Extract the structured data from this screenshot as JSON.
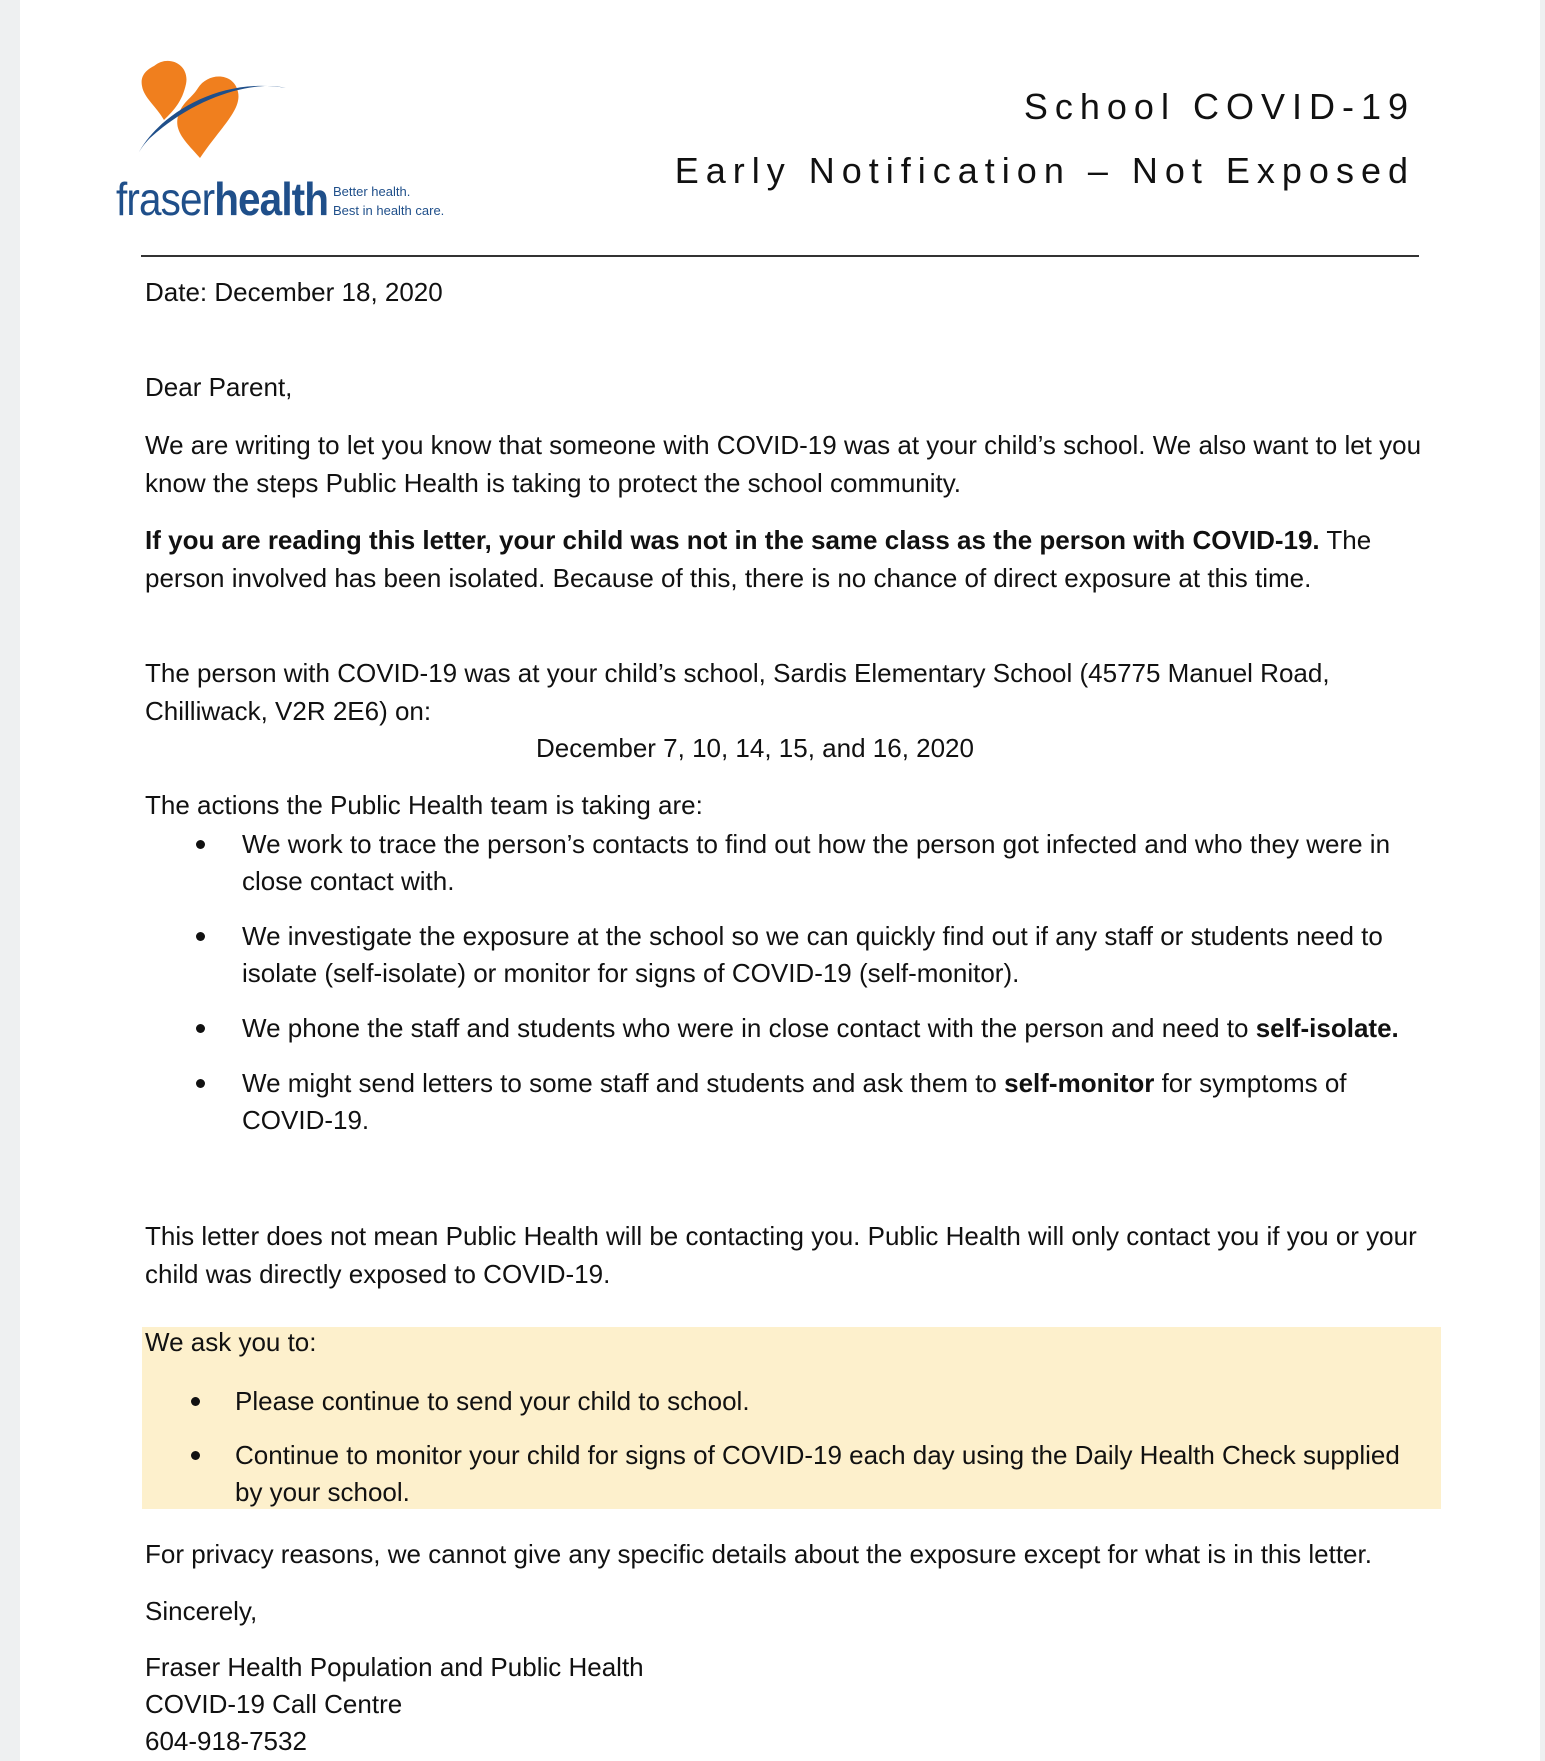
{
  "header": {
    "logo": {
      "word_light": "fraser",
      "word_bold": "health",
      "tagline_1": "Better health.",
      "tagline_2": "Best in health care."
    },
    "title_line_1": "School COVID-19",
    "title_line_2": "Early Notification – Not Exposed"
  },
  "letter": {
    "date": "Date: December 18, 2020",
    "salutation": "Dear Parent,",
    "para_1": "We are writing to let you know that someone with COVID-19 was at your child’s school. We also want to let you know the steps Public Health is taking to protect the school community.",
    "para_2_bold": "If you are reading this letter, your child was not in the same class as the person with COVID-19.",
    "para_2_rest": " The person involved has been isolated. Because of this, there is no chance of direct exposure at this time.",
    "para_3": "The person with COVID-19 was at your child’s school, Sardis Elementary School (45775 Manuel Road, Chilliwack, V2R 2E6) on:",
    "dates": "December 7, 10, 14, 15, and 16, 2020",
    "actions_intro": "The actions the Public Health team is taking are:",
    "actions": [
      {
        "text": "We work to trace the person’s contacts to find out how the person got infected and who they were in close contact with.",
        "bold": ""
      },
      {
        "text": "We investigate the exposure at the school so we can quickly find out if any staff or students need to isolate (self-isolate) or monitor for signs of COVID-19 (self-monitor).",
        "bold": ""
      },
      {
        "text": "We phone the staff and students who were in close contact with the person and need to ",
        "bold": "self-isolate."
      },
      {
        "text_before": "We might send letters to some staff and students and ask them to ",
        "bold": "self-monitor",
        "text_after": " for symptoms of COVID-19."
      }
    ],
    "para_4": "This letter does not mean Public Health will be contacting you. Public Health will only contact you if you or your child was directly exposed to COVID-19.",
    "ask_intro": "We ask you to:",
    "asks": [
      "Please continue to send your child to school.",
      "Continue to monitor your child for signs of COVID-19 each day using the Daily Health Check supplied by your school."
    ],
    "privacy": "For privacy reasons, we cannot give any specific details about the exposure except for what is in this letter.",
    "closing": "Sincerely,",
    "signature_1": "Fraser Health Population and Public Health",
    "signature_2": "COVID-19 Call Centre",
    "signature_3": "604-918-7532"
  },
  "colors": {
    "logo_orange": "#f07f1e",
    "logo_blue": "#1f4f8a",
    "highlight": "#fdf0cc"
  }
}
